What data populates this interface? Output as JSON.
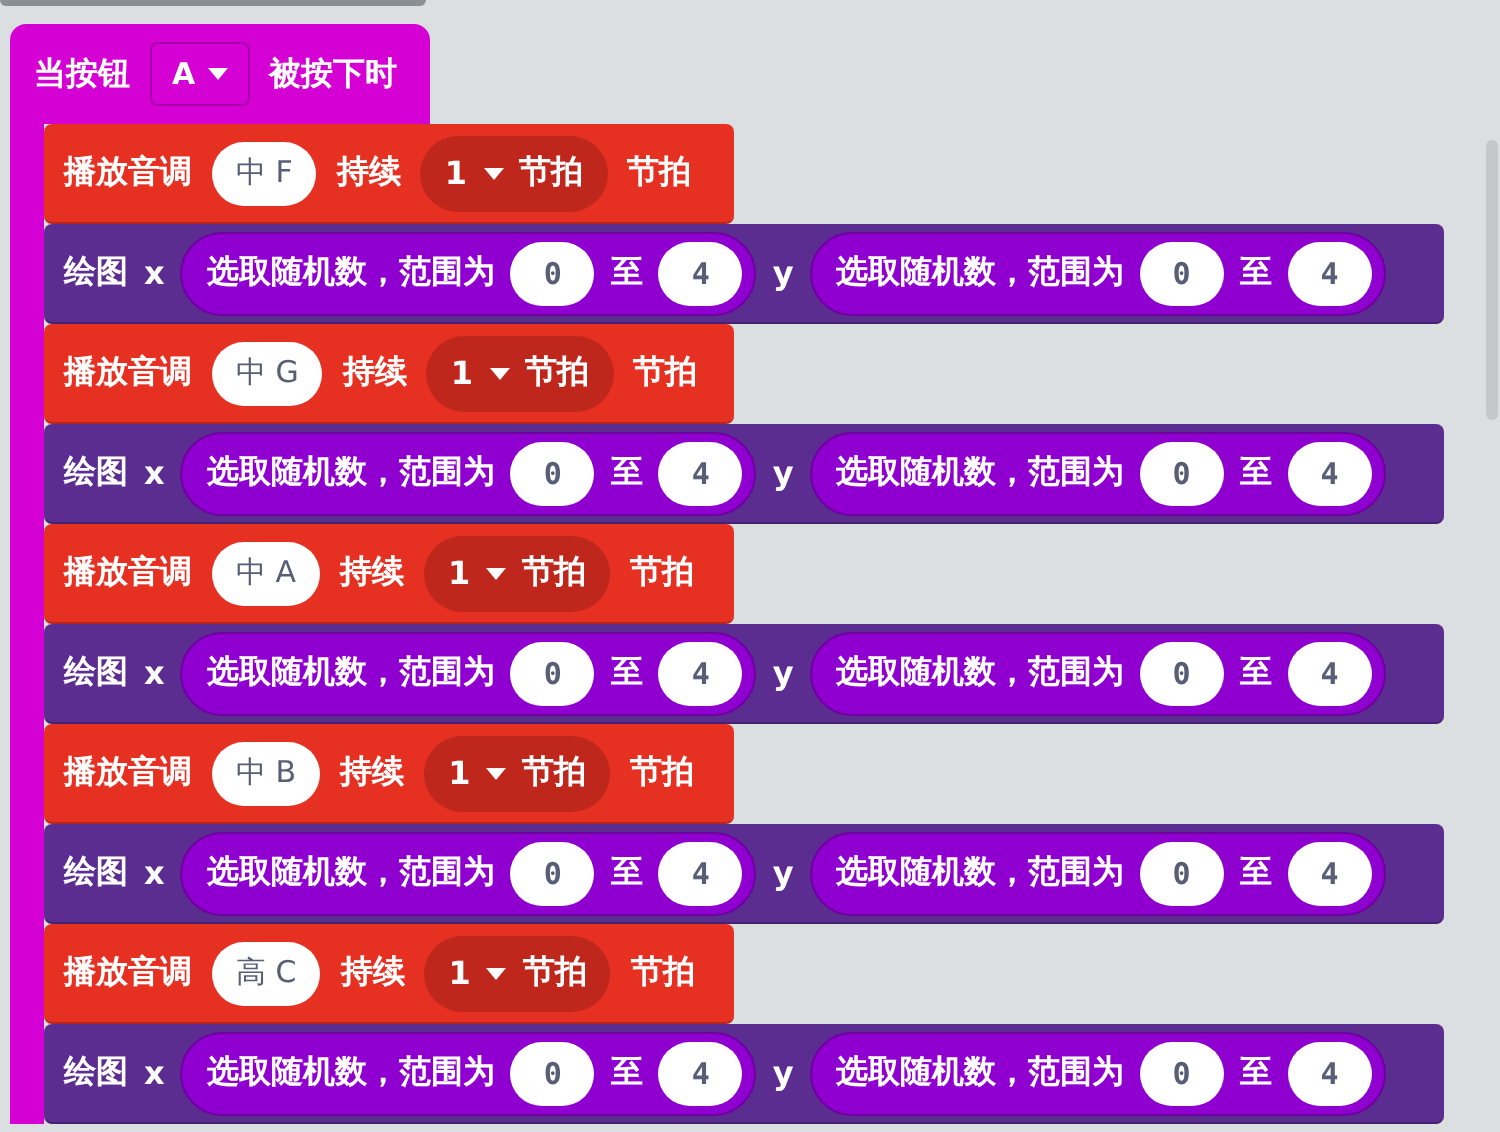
{
  "event": {
    "label": "当按钮",
    "button": "A",
    "suffix": "被按下时"
  },
  "statements": [
    {
      "kind": "tone",
      "label": "播放音调",
      "note": "中 F",
      "duration_label": "持续",
      "beats": "1",
      "beats_unit": "节拍",
      "suffix": "节拍"
    },
    {
      "kind": "plot",
      "label": "绘图",
      "x_label": "x",
      "x": {
        "label": "选取随机数，范围为",
        "from": "0",
        "to_label": "至",
        "to": "4"
      },
      "y_label": "y",
      "y": {
        "label": "选取随机数，范围为",
        "from": "0",
        "to_label": "至",
        "to": "4"
      }
    },
    {
      "kind": "tone",
      "label": "播放音调",
      "note": "中 G",
      "duration_label": "持续",
      "beats": "1",
      "beats_unit": "节拍",
      "suffix": "节拍"
    },
    {
      "kind": "plot",
      "label": "绘图",
      "x_label": "x",
      "x": {
        "label": "选取随机数，范围为",
        "from": "0",
        "to_label": "至",
        "to": "4"
      },
      "y_label": "y",
      "y": {
        "label": "选取随机数，范围为",
        "from": "0",
        "to_label": "至",
        "to": "4"
      }
    },
    {
      "kind": "tone",
      "label": "播放音调",
      "note": "中 A",
      "duration_label": "持续",
      "beats": "1",
      "beats_unit": "节拍",
      "suffix": "节拍"
    },
    {
      "kind": "plot",
      "label": "绘图",
      "x_label": "x",
      "x": {
        "label": "选取随机数，范围为",
        "from": "0",
        "to_label": "至",
        "to": "4"
      },
      "y_label": "y",
      "y": {
        "label": "选取随机数，范围为",
        "from": "0",
        "to_label": "至",
        "to": "4"
      }
    },
    {
      "kind": "tone",
      "label": "播放音调",
      "note": "中 B",
      "duration_label": "持续",
      "beats": "1",
      "beats_unit": "节拍",
      "suffix": "节拍"
    },
    {
      "kind": "plot",
      "label": "绘图",
      "x_label": "x",
      "x": {
        "label": "选取随机数，范围为",
        "from": "0",
        "to_label": "至",
        "to": "4"
      },
      "y_label": "y",
      "y": {
        "label": "选取随机数，范围为",
        "from": "0",
        "to_label": "至",
        "to": "4"
      }
    },
    {
      "kind": "tone",
      "label": "播放音调",
      "note": "高 C",
      "duration_label": "持续",
      "beats": "1",
      "beats_unit": "节拍",
      "suffix": "节拍"
    },
    {
      "kind": "plot",
      "label": "绘图",
      "x_label": "x",
      "x": {
        "label": "选取随机数，范围为",
        "from": "0",
        "to_label": "至",
        "to": "4"
      },
      "y_label": "y",
      "y": {
        "label": "选取随机数，范围为",
        "from": "0",
        "to_label": "至",
        "to": "4"
      }
    }
  ]
}
